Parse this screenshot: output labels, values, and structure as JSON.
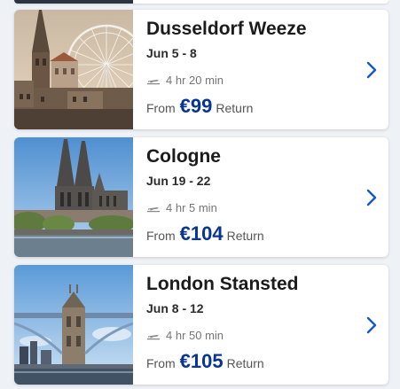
{
  "destinations": [
    {
      "city": "Dusseldorf Weeze",
      "dates": "Jun 5 - 8",
      "duration": "4 hr 20 min",
      "from_label": "From",
      "price": "€99",
      "trip_type": "Return"
    },
    {
      "city": "Cologne",
      "dates": "Jun 19 - 22",
      "duration": "4 hr 5 min",
      "from_label": "From",
      "price": "€104",
      "trip_type": "Return"
    },
    {
      "city": "London Stansted",
      "dates": "Jun 8 - 12",
      "duration": "4 hr 50 min",
      "from_label": "From",
      "price": "€105",
      "trip_type": "Return"
    }
  ],
  "colors": {
    "price": "#073590",
    "chevron": "#1a56c8",
    "background": "#eef1f5"
  },
  "icons": {
    "flight": "plane-icon",
    "navigate": "chevron-right-icon"
  }
}
